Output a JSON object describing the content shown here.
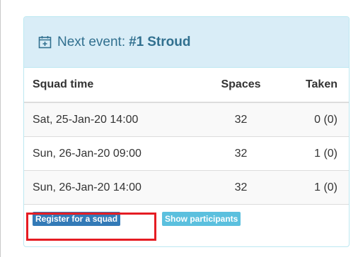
{
  "heading": {
    "prefix": "Next event:",
    "event_number": "#1",
    "event_name": "Stroud",
    "icon": "calendar-plus-icon"
  },
  "table": {
    "headers": {
      "time": "Squad time",
      "spaces": "Spaces",
      "taken": "Taken"
    },
    "rows": [
      {
        "time": "Sat, 25-Jan-20 14:00",
        "spaces": "32",
        "taken": "0 (0)"
      },
      {
        "time": "Sun, 26-Jan-20 09:00",
        "spaces": "32",
        "taken": "1 (0)"
      },
      {
        "time": "Sun, 26-Jan-20 14:00",
        "spaces": "32",
        "taken": "1 (0)"
      }
    ]
  },
  "actions": {
    "register_label": "Register for a squad",
    "participants_label": "Show participants"
  },
  "colors": {
    "heading_bg": "#d9edf7",
    "heading_text": "#31708f",
    "register_button": "#337ab7",
    "participants_button": "#5bc0de",
    "highlight_border": "#e51c23"
  }
}
